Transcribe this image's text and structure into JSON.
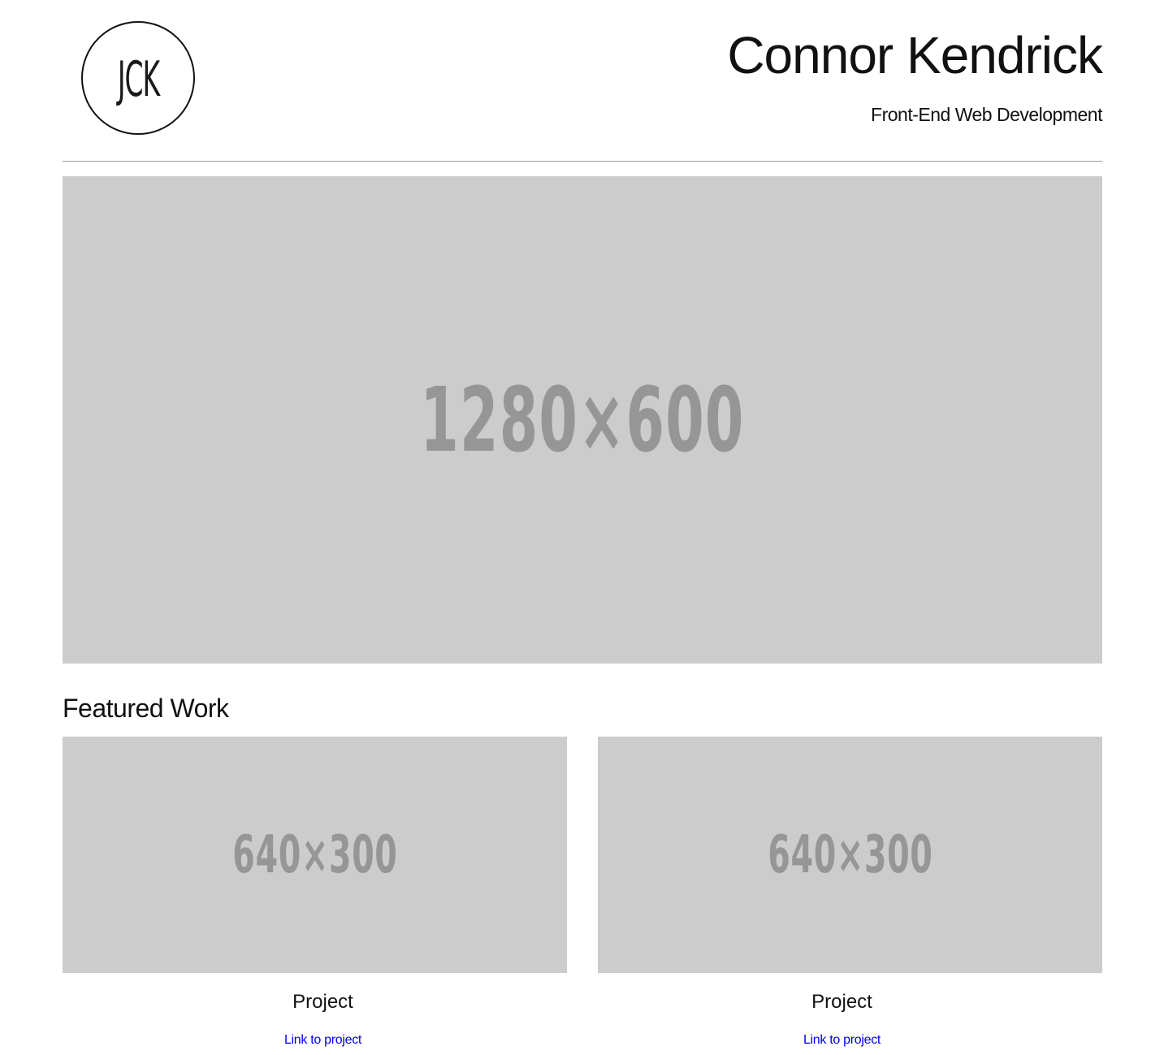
{
  "header": {
    "logo_text": "JCK",
    "title": "Connor Kendrick",
    "subtitle": "Front-End Web Development"
  },
  "hero": {
    "placeholder_label": "1280×600"
  },
  "featured": {
    "heading": "Featured Work",
    "cards": [
      {
        "placeholder_label": "640×300",
        "title": "Project",
        "link_label": "Link to project"
      },
      {
        "placeholder_label": "640×300",
        "title": "Project",
        "link_label": "Link to project"
      }
    ]
  },
  "colors": {
    "placeholder_bg": "#cccccc",
    "placeholder_text": "#969696",
    "link": "#0000ee",
    "divider": "#9a9a9a"
  }
}
